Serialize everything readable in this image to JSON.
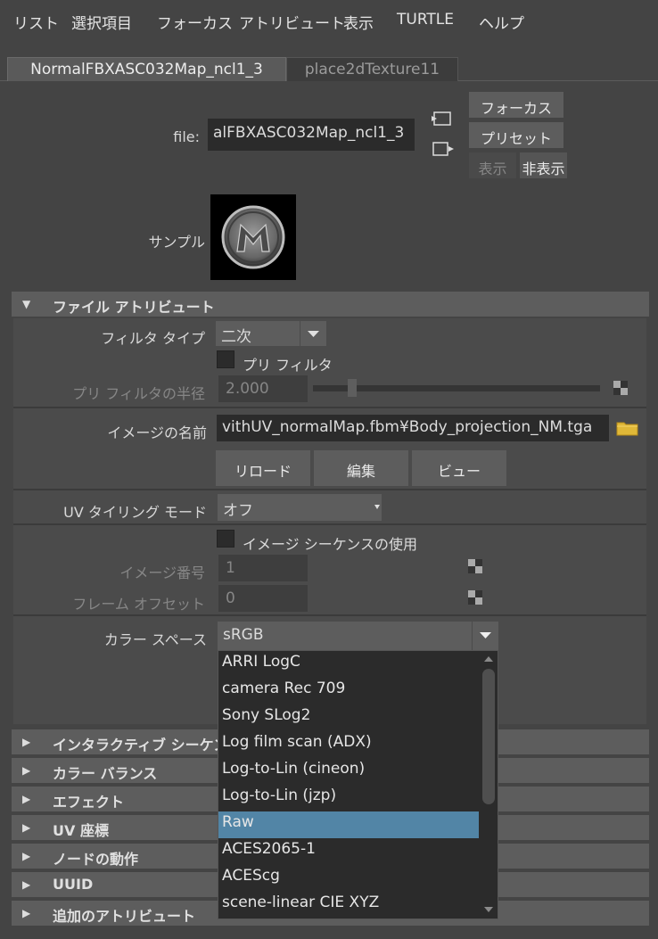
{
  "menu": [
    "リスト",
    "選択項目",
    "フォーカス",
    "アトリビュート",
    "表示",
    "TURTLE",
    "ヘルプ"
  ],
  "tabs": [
    {
      "label": "NormalFBXASC032Map_ncl1_3",
      "active": true
    },
    {
      "label": "place2dTexture11",
      "active": false
    }
  ],
  "header": {
    "file_label": "file:",
    "file_value": "alFBXASC032Map_ncl1_3",
    "focus_button": "フォーカス",
    "preset_button": "プリセット",
    "show_button": "表示",
    "hide_button": "非表示",
    "sample_label": "サンプル"
  },
  "file_attributes": {
    "section_title": "ファイル アトリビュート",
    "filter_type_label": "フィルタ タイプ",
    "filter_type_value": "二次",
    "prefilter_label": "プリ フィルタ",
    "prefilter_radius_label": "プリ フィルタの半径",
    "prefilter_radius_value": "2.000",
    "prefilter_radius_fraction": 0.125,
    "image_name_label": "イメージの名前",
    "image_name_value": "vithUV_normalMap.fbm¥Body_projection_NM.tga",
    "reload_button": "リロード",
    "edit_button": "編集",
    "view_button": "ビュー",
    "uv_tiling_label": "UV タイリング モード",
    "uv_tiling_value": "オフ",
    "use_sequence_label": "イメージ シーケンスの使用",
    "image_number_label": "イメージ番号",
    "image_number_value": "1",
    "frame_offset_label": "フレーム オフセット",
    "frame_offset_value": "0",
    "color_space_label": "カラー スペース",
    "color_space_value": "sRGB"
  },
  "color_space_options": [
    "ARRI LogC",
    "camera Rec 709",
    "Sony SLog2",
    "Log film scan (ADX)",
    "Log-to-Lin (cineon)",
    "Log-to-Lin (jzp)",
    "Raw",
    "ACES2065-1",
    "ACEScg",
    "scene-linear CIE XYZ"
  ],
  "color_space_highlighted": "Raw",
  "collapsed_sections": [
    "インタラクティブ シーケン",
    "カラー バランス",
    "エフェクト",
    "UV 座標",
    "ノードの動作",
    "UUID",
    "追加のアトリビュート"
  ],
  "colors": {
    "panel": "#444444",
    "field": "#2b2b2b",
    "button": "#5d5d5d",
    "highlight": "#5285a6"
  }
}
